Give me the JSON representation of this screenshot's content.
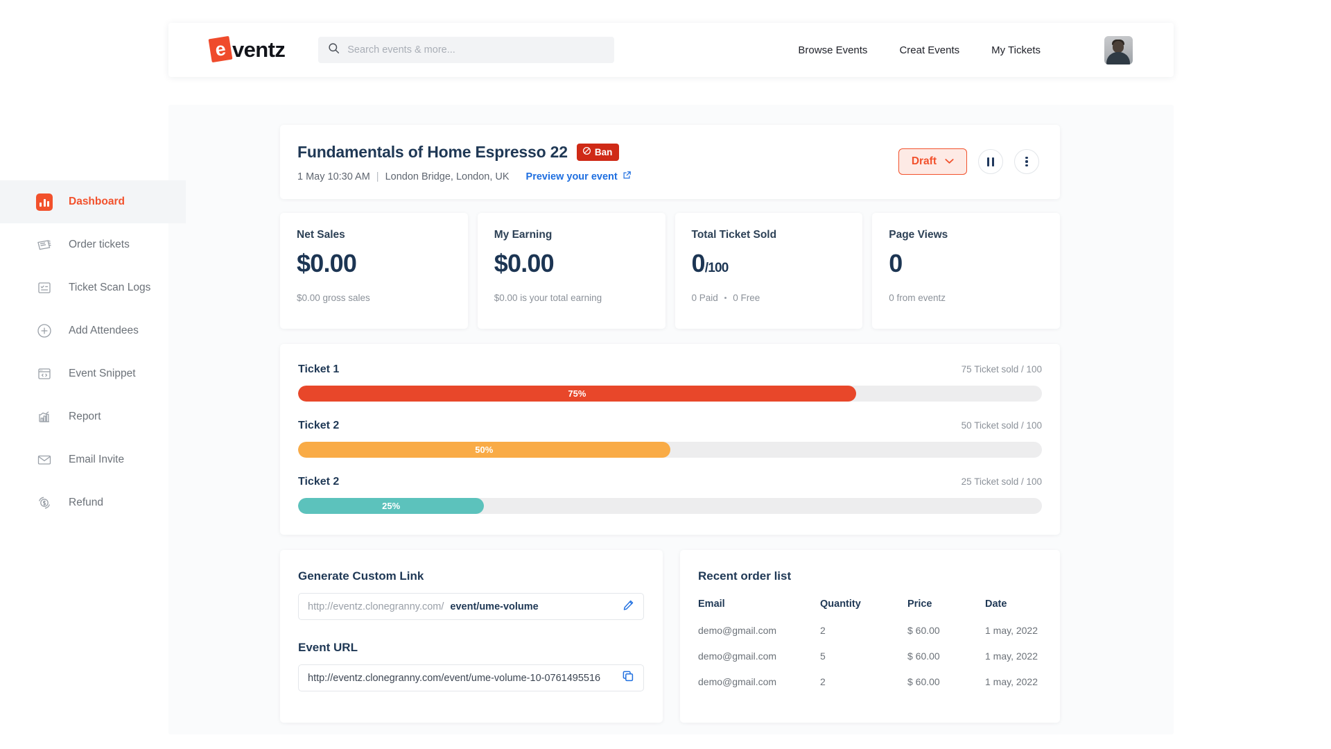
{
  "brand": {
    "logo_letter": "e",
    "logo_text": "ventz"
  },
  "search": {
    "placeholder": "Search events & more...",
    "icon": "search-icon"
  },
  "nav": {
    "items": [
      {
        "label": "Browse Events"
      },
      {
        "label": "Creat Events"
      },
      {
        "label": "My Tickets"
      }
    ],
    "avatar": "user-avatar"
  },
  "sidebar": {
    "items": [
      {
        "label": "Dashboard",
        "icon": "bar-chart-icon",
        "active": true
      },
      {
        "label": "Order tickets",
        "icon": "ticket-icon",
        "active": false
      },
      {
        "label": "Ticket Scan Logs",
        "icon": "checklist-icon",
        "active": false
      },
      {
        "label": "Add Attendees",
        "icon": "plus-circle-icon",
        "active": false
      },
      {
        "label": "Event Snippet",
        "icon": "code-window-icon",
        "active": false
      },
      {
        "label": "Report",
        "icon": "report-chart-icon",
        "active": false
      },
      {
        "label": "Email Invite",
        "icon": "envelope-icon",
        "active": false
      },
      {
        "label": "Refund",
        "icon": "refund-dollar-icon",
        "active": false
      }
    ]
  },
  "event": {
    "title": "Fundamentals of Home Espresso 22",
    "badge": {
      "label": "Ban",
      "icon": "ban-icon",
      "color": "#cf2a16"
    },
    "datetime": "1 May 10:30 AM",
    "separator": "|",
    "location": "London Bridge, London, UK",
    "preview_label": "Preview your event",
    "preview_icon": "external-link-icon",
    "status_button": {
      "label": "Draft",
      "icon": "chevron-down-icon",
      "color": "#f2512c"
    },
    "pause_button": "pause-icon",
    "more_button": "more-vertical-icon"
  },
  "stats": [
    {
      "label": "Net Sales",
      "value": "$0.00",
      "suffix": "",
      "sub": "$0.00 gross sales"
    },
    {
      "label": "My Earning",
      "value": "$0.00",
      "suffix": "",
      "sub": "$0.00 is your total earning"
    },
    {
      "label": "Total Ticket Sold",
      "value": "0",
      "suffix": "/100",
      "sub_left": "0 Paid",
      "sub_right": "0 Free"
    },
    {
      "label": "Page Views",
      "value": "0",
      "suffix": "",
      "sub": "0 from eventz"
    }
  ],
  "tickets": [
    {
      "name": "Ticket 1",
      "count_text": "75 Ticket sold / 100",
      "percent": 75,
      "percent_label": "75%",
      "color": "#e8472a"
    },
    {
      "name": "Ticket 2",
      "count_text": "50 Ticket sold / 100",
      "percent": 50,
      "percent_label": "50%",
      "color": "#f9ab46"
    },
    {
      "name": "Ticket 2",
      "count_text": "25 Ticket sold / 100",
      "percent": 25,
      "percent_label": "25%",
      "color": "#5cc2bc"
    }
  ],
  "custom_link": {
    "title": "Generate Custom Link",
    "prefix": "http://eventz.clonegranny.com/",
    "value": "event/ume-volume",
    "edit_icon": "pencil-icon"
  },
  "event_url": {
    "label": "Event URL",
    "value": "http://eventz.clonegranny.com/event/ume-volume-10-0761495516",
    "copy_icon": "copy-icon"
  },
  "orders": {
    "title": "Recent order list",
    "columns": [
      "Email",
      "Quantity",
      "Price",
      "Date"
    ],
    "rows": [
      {
        "email": "demo@gmail.com",
        "quantity": "2",
        "price": "$ 60.00",
        "date": "1 may, 2022"
      },
      {
        "email": "demo@gmail.com",
        "quantity": "5",
        "price": "$ 60.00",
        "date": "1 may, 2022"
      },
      {
        "email": "demo@gmail.com",
        "quantity": "2",
        "price": "$ 60.00",
        "date": "1 may, 2022"
      }
    ]
  }
}
